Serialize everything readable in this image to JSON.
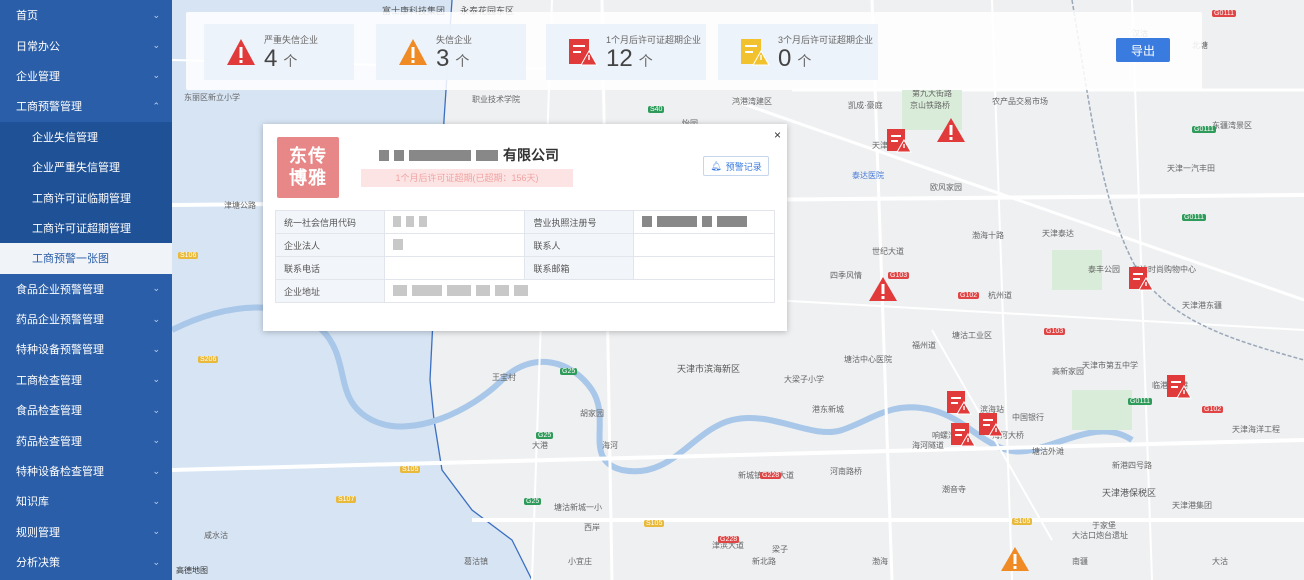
{
  "sidebar": {
    "items": [
      {
        "label": "首页"
      },
      {
        "label": "日常办公"
      },
      {
        "label": "企业管理"
      },
      {
        "label": "工商预警管理",
        "expanded": true,
        "children": [
          {
            "label": "企业失信管理"
          },
          {
            "label": "企业严重失信管理"
          },
          {
            "label": "工商许可证临期管理"
          },
          {
            "label": "工商许可证超期管理"
          },
          {
            "label": "工商预警一张图",
            "active": true
          }
        ]
      },
      {
        "label": "食品企业预警管理"
      },
      {
        "label": "药品企业预警管理"
      },
      {
        "label": "特种设备预警管理"
      },
      {
        "label": "工商检查管理"
      },
      {
        "label": "食品检查管理"
      },
      {
        "label": "药品检查管理"
      },
      {
        "label": "特种设备检查管理"
      },
      {
        "label": "知识库"
      },
      {
        "label": "规则管理"
      },
      {
        "label": "分析决策"
      }
    ]
  },
  "stats": [
    {
      "label": "严重失信企业",
      "value": "4",
      "unit": "个",
      "icon": "warning-triangle-red-icon",
      "color": "#e03a3a"
    },
    {
      "label": "失信企业",
      "value": "3",
      "unit": "个",
      "icon": "warning-triangle-orange-icon",
      "color": "#f08a24"
    },
    {
      "label": "1个月后许可证超期企业",
      "value": "12",
      "unit": "个",
      "icon": "license-warning-red-icon",
      "color": "#e03a3a"
    },
    {
      "label": "3个月后许可证超期企业",
      "value": "0",
      "unit": "个",
      "icon": "license-warning-yellow-icon",
      "color": "#f2c12e"
    }
  ],
  "export_label": "导出",
  "popup": {
    "logo_line1": "东传",
    "logo_line2": "博雅",
    "company_suffix": "有限公司",
    "expiry_note": "1个月后许可证超期(已超期：156天)",
    "record_label": "预警记录",
    "close": "×",
    "fields": {
      "credit_code_label": "统一社会信用代码",
      "license_no_label": "营业执照注册号",
      "legal_person_label": "企业法人",
      "contact_label": "联系人",
      "phone_label": "联系电话",
      "email_label": "联系邮箱",
      "address_label": "企业地址"
    }
  },
  "map": {
    "provider": "高德地图",
    "labels": [
      "富士康科技集团",
      "永泰花园东区",
      "第九大街路",
      "天津一汽丰田",
      "东丽区新立小学",
      "职业技术学院",
      "农产品交易市场",
      "鸿港湾建区",
      "怡园",
      "凯成·豪庭",
      "京山铁路桥",
      "天津市滨海新区",
      "泰达医院",
      "欧风家园",
      "世纪大道",
      "天津泰达",
      "津滨大道",
      "滨海站",
      "四季风情",
      "塘沽工业区",
      "天津市第五中学",
      "塘沽中心医院",
      "大梁子小学",
      "天津海洋工程",
      "天津港保税区",
      "于家堡",
      "潮音寺",
      "海河隧道",
      "高新家园",
      "大沽口炮台遗址",
      "北塘",
      "新港",
      "天津大道",
      "河南路桥",
      "新城镇",
      "塘沽新城一小",
      "海河",
      "梁子",
      "王宝村",
      "小宜庄",
      "胡家园",
      "港东新城",
      "响螺湾",
      "渤海",
      "南疆",
      "葛沽镇",
      "天津港东疆",
      "咸水沽",
      "西岸",
      "东疆湾景区",
      "中国银行",
      "汉沽",
      "泰丰公园",
      "泰达时尚购物中心",
      "塘沽外滩",
      "天津港集团",
      "新港四号路",
      "津塘公路",
      "天津大学",
      "海河大桥",
      "大沽",
      "大港",
      "新北路",
      "临港",
      "渤海十路",
      "福州道",
      "杭州道"
    ]
  }
}
